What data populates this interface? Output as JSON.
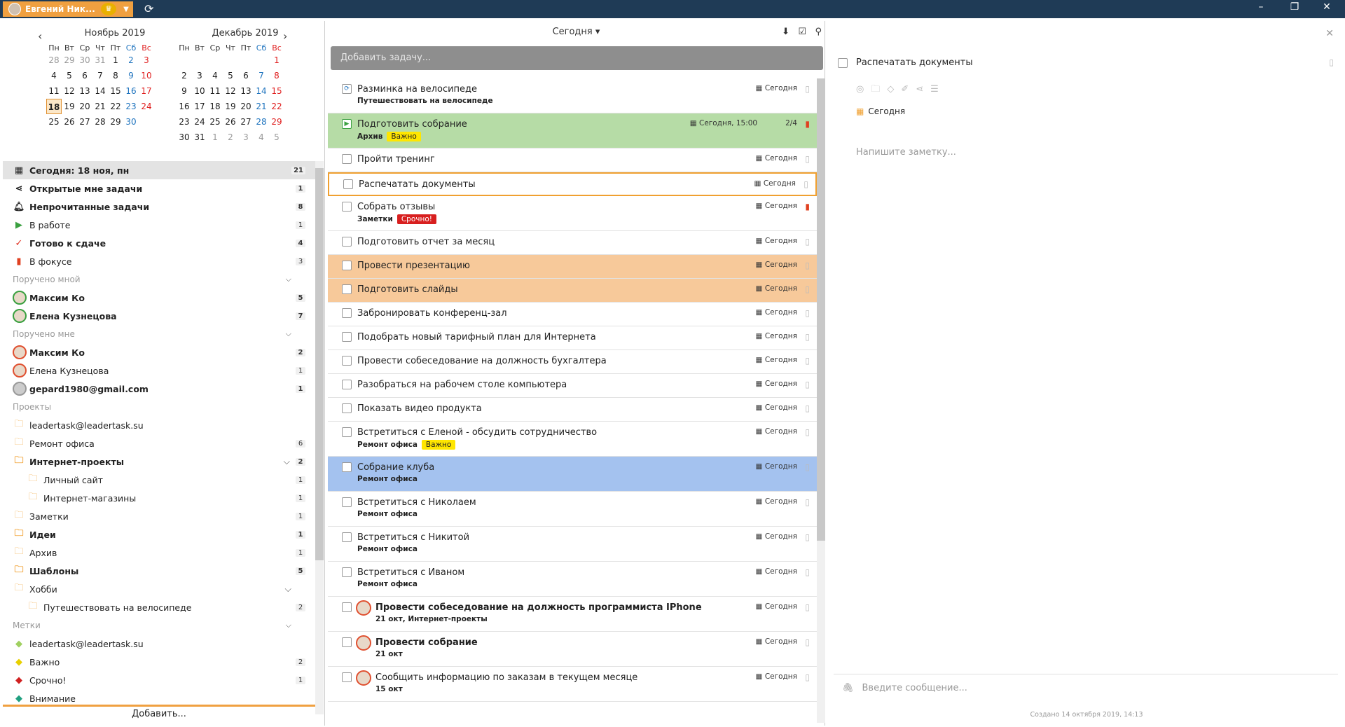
{
  "titlebar": {
    "user_name": "Евгений Ник...",
    "minimize": "–",
    "maximize": "❐",
    "close": "✕"
  },
  "calendar": {
    "prev": "‹",
    "next": "›",
    "months": [
      {
        "title": "Ноябрь 2019",
        "days": [
          "Пн",
          "Вт",
          "Ср",
          "Чт",
          "Пт",
          "Сб",
          "Вс"
        ],
        "weeks": [
          [
            "28",
            "29",
            "30",
            "31",
            "1",
            "2",
            "3"
          ],
          [
            "4",
            "5",
            "6",
            "7",
            "8",
            "9",
            "10"
          ],
          [
            "11",
            "12",
            "13",
            "14",
            "15",
            "16",
            "17"
          ],
          [
            "18",
            "19",
            "20",
            "21",
            "22",
            "23",
            "24"
          ],
          [
            "25",
            "26",
            "27",
            "28",
            "29",
            "30",
            ""
          ]
        ]
      },
      {
        "title": "Декабрь 2019",
        "days": [
          "Пн",
          "Вт",
          "Ср",
          "Чт",
          "Пт",
          "Сб",
          "Вс"
        ],
        "weeks": [
          [
            "",
            "",
            "",
            "",
            "",
            "",
            "1"
          ],
          [
            "2",
            "3",
            "4",
            "5",
            "6",
            "7",
            "8"
          ],
          [
            "9",
            "10",
            "11",
            "12",
            "13",
            "14",
            "15"
          ],
          [
            "16",
            "17",
            "18",
            "19",
            "20",
            "21",
            "22"
          ],
          [
            "23",
            "24",
            "25",
            "26",
            "27",
            "28",
            "29"
          ],
          [
            "30",
            "31",
            "1",
            "2",
            "3",
            "4",
            "5"
          ]
        ]
      }
    ]
  },
  "nav": {
    "today": {
      "label": "Сегодня: 18 ноя, пн",
      "count": "21"
    },
    "open": {
      "label": "Открытые мне задачи",
      "count": "1"
    },
    "unread": {
      "label": "Непрочитанные задачи",
      "count": "8"
    },
    "inwork": {
      "label": "В работе",
      "count": "1"
    },
    "ready": {
      "label": "Готово к сдаче",
      "count": "4"
    },
    "focus": {
      "label": "В фокусе",
      "count": "3"
    },
    "assigned_by_me": "Поручено мной",
    "abm": [
      {
        "label": "Максим Ко",
        "count": "5"
      },
      {
        "label": "Елена Кузнецова",
        "count": "7"
      }
    ],
    "assigned_to_me": "Поручено мне",
    "atm": [
      {
        "label": "Максим Ко",
        "count": "2"
      },
      {
        "label": "Елена Кузнецова",
        "count": "1"
      },
      {
        "label": "gepard1980@gmail.com",
        "count": "1"
      }
    ],
    "projects": "Проекты",
    "proj": [
      {
        "label": "leadertask@leadertask.su",
        "count": ""
      },
      {
        "label": "Ремонт офиса",
        "count": "6"
      },
      {
        "label": "Интернет-проекты",
        "count": "2"
      },
      {
        "label": "Личный сайт",
        "count": "1"
      },
      {
        "label": "Интернет-магазины",
        "count": "1"
      },
      {
        "label": "Заметки",
        "count": "1"
      },
      {
        "label": "Идеи",
        "count": "1"
      },
      {
        "label": "Архив",
        "count": "1"
      },
      {
        "label": "Шаблоны",
        "count": "5"
      },
      {
        "label": "Хобби",
        "count": ""
      },
      {
        "label": "Путешествовать на велосипеде",
        "count": "2"
      }
    ],
    "tags": "Метки",
    "tg": [
      {
        "label": "leadertask@leadertask.su",
        "count": ""
      },
      {
        "label": "Важно",
        "count": "2"
      },
      {
        "label": "Срочно!",
        "count": "1"
      },
      {
        "label": "Внимание",
        "count": ""
      }
    ],
    "add": "Добавить..."
  },
  "main": {
    "filter": "Сегодня ▾",
    "add_placeholder": "Добавить задачу...",
    "tasks": [
      {
        "title": "Разминка на велосипеде",
        "sub": "Путешествовать на велосипеде",
        "date": "Сегодня"
      },
      {
        "title": "Подготовить собрание",
        "sub": "Архив",
        "tag": "Важно",
        "date": "Сегодня, 15:00",
        "extra": "2/4"
      },
      {
        "title": "Пройти тренинг",
        "date": "Сегодня"
      },
      {
        "title": "Распечатать документы",
        "date": "Сегодня"
      },
      {
        "title": "Собрать отзывы",
        "sub": "Заметки",
        "tag": "Срочно!",
        "date": "Сегодня"
      },
      {
        "title": "Подготовить отчет за месяц",
        "date": "Сегодня"
      },
      {
        "title": "Провести презентацию",
        "date": "Сегодня"
      },
      {
        "title": "Подготовить слайды",
        "date": "Сегодня"
      },
      {
        "title": "Забронировать конференц-зал",
        "date": "Сегодня"
      },
      {
        "title": "Подобрать новый тарифный план для Интернета",
        "date": "Сегодня"
      },
      {
        "title": "Провести собеседование на должность бухгалтера",
        "date": "Сегодня"
      },
      {
        "title": "Разобраться на рабочем столе компьютера",
        "date": "Сегодня"
      },
      {
        "title": "Показать видео продукта",
        "date": "Сегодня"
      },
      {
        "title": "Встретиться с Еленой - обсудить сотрудничество",
        "sub": "Ремонт офиса",
        "tag": "Важно",
        "date": "Сегодня"
      },
      {
        "title": "Собрание клуба",
        "sub": "Ремонт офиса",
        "date": "Сегодня"
      },
      {
        "title": "Встретиться с Николаем",
        "sub": "Ремонт офиса",
        "date": "Сегодня"
      },
      {
        "title": "Встретиться с Никитой",
        "sub": "Ремонт офиса",
        "date": "Сегодня"
      },
      {
        "title": "Встретиться с Иваном",
        "sub": "Ремонт офиса",
        "date": "Сегодня"
      },
      {
        "title": "Провести собеседование на должность программиста IPhone",
        "sub": "21 окт, Интернет-проекты",
        "date": "Сегодня"
      },
      {
        "title": "Провести собрание",
        "sub": "21 окт",
        "date": "Сегодня"
      },
      {
        "title": "Сообщить информацию по заказам в текущем месяце",
        "sub": "15 окт",
        "date": "Сегодня"
      }
    ]
  },
  "detail": {
    "title": "Распечатать документы",
    "date": "Сегодня",
    "note_placeholder": "Напишите заметку...",
    "message_placeholder": "Введите сообщение...",
    "created": "Создано 14 октября 2019, 14:13"
  },
  "colors": {
    "accent": "#f0a040",
    "titlebar": "#1f3b56",
    "green": "#b6dca6",
    "orange": "#f7c99a",
    "blue": "#a4c2ef",
    "red_tag": "#d81f1f",
    "yellow_tag": "#ffe600"
  }
}
